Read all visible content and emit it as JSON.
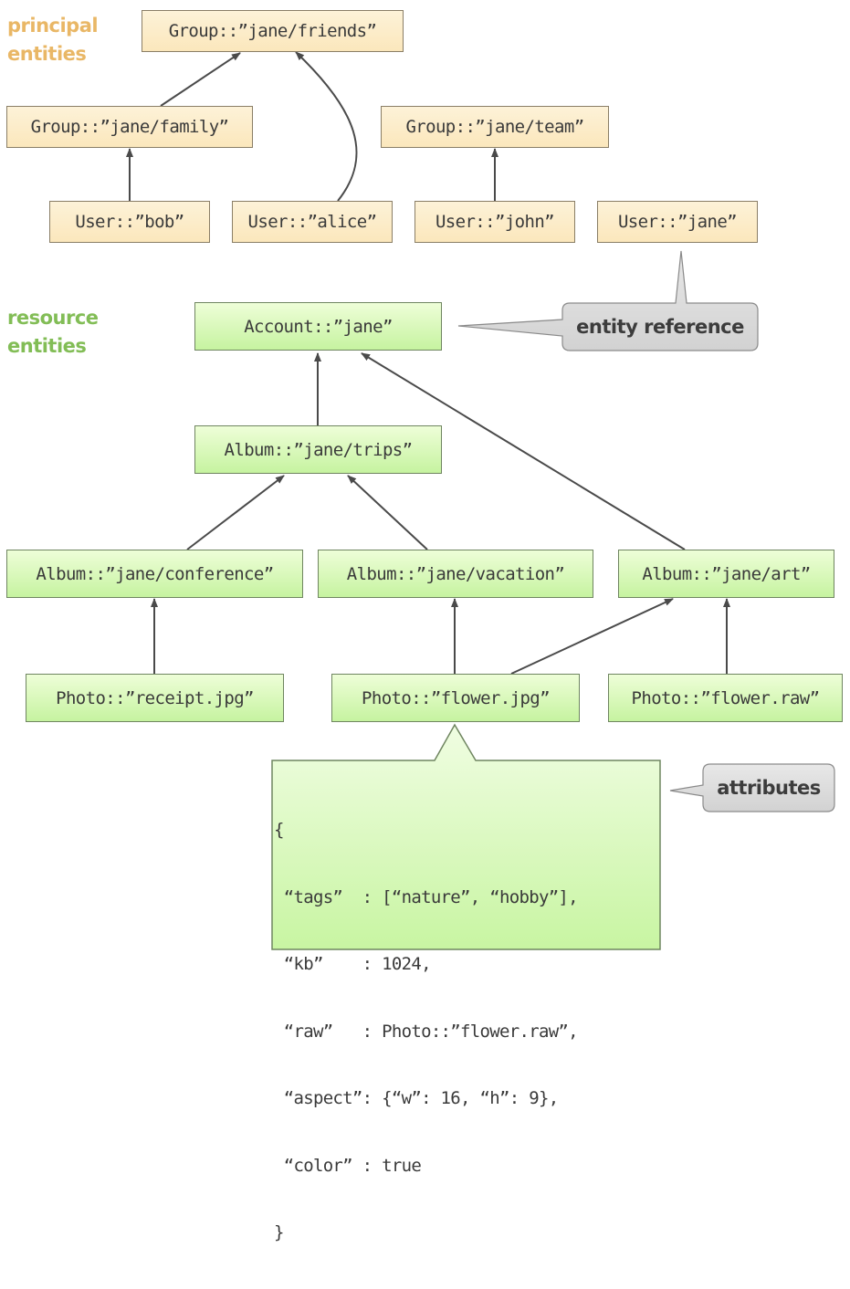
{
  "sections": {
    "principal": {
      "label": "principal entities",
      "color": "#e9b766"
    },
    "resource": {
      "label": "resource entities",
      "color": "#82bd56"
    }
  },
  "nodes": {
    "group_friends": "Group::”jane/friends”",
    "group_family": "Group::”jane/family”",
    "group_team": "Group::”jane/team”",
    "user_bob": "User::”bob”",
    "user_alice": "User::”alice”",
    "user_john": "User::”john”",
    "user_jane": "User::”jane”",
    "account_jane": "Account::”jane”",
    "album_trips": "Album::”jane/trips”",
    "album_conference": "Album::”jane/conference”",
    "album_vacation": "Album::”jane/vacation”",
    "album_art": "Album::”jane/art”",
    "photo_receipt": "Photo::”receipt.jpg”",
    "photo_flower_jpg": "Photo::”flower.jpg”",
    "photo_flower_raw": "Photo::”flower.raw”"
  },
  "edges": [
    {
      "from": "group_family",
      "to": "group_friends"
    },
    {
      "from": "user_alice",
      "to": "group_friends"
    },
    {
      "from": "user_bob",
      "to": "group_family"
    },
    {
      "from": "user_john",
      "to": "group_team"
    },
    {
      "from": "album_trips",
      "to": "account_jane"
    },
    {
      "from": "album_art",
      "to": "account_jane"
    },
    {
      "from": "album_conference",
      "to": "album_trips"
    },
    {
      "from": "album_vacation",
      "to": "album_trips"
    },
    {
      "from": "photo_receipt",
      "to": "album_conference"
    },
    {
      "from": "photo_flower_jpg",
      "to": "album_vacation"
    },
    {
      "from": "photo_flower_jpg",
      "to": "album_art"
    },
    {
      "from": "photo_flower_raw",
      "to": "album_art"
    }
  ],
  "callouts": {
    "entity_reference": "entity reference",
    "attributes": "attributes"
  },
  "attributes_block": {
    "lines": [
      "{",
      " “tags”  : [“nature”, “hobby”],",
      " “kb”    : 1024,",
      " “raw”   : Photo::”flower.raw”,",
      " “aspect”: {“w”: 16, “h”: 9},",
      " “color” : true",
      "}"
    ]
  },
  "colors": {
    "principal_fill": "#fbe9c4",
    "resource_fill": "#d6f7b6",
    "callout_fill": "#dcdcdc",
    "edge": "#4a4a4a"
  }
}
